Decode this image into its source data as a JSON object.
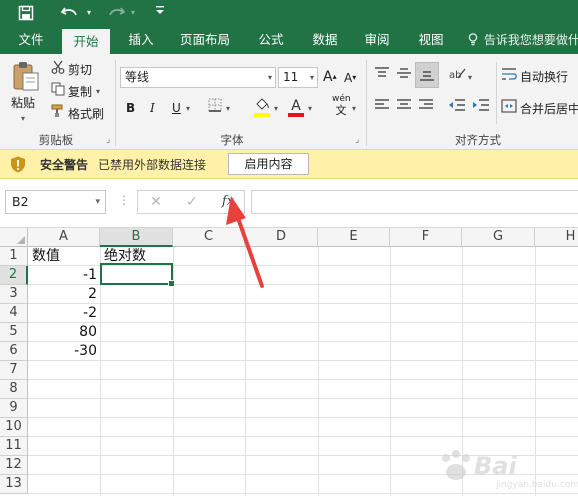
{
  "quick_access": {
    "save_icon": "save-icon",
    "undo_icon": "undo-icon",
    "redo_icon": "redo-icon",
    "customize_icon": "customize-qat-icon"
  },
  "tabs": [
    {
      "label": "文件"
    },
    {
      "label": "开始",
      "active": true
    },
    {
      "label": "插入"
    },
    {
      "label": "页面布局"
    },
    {
      "label": "公式"
    },
    {
      "label": "数据"
    },
    {
      "label": "审阅"
    },
    {
      "label": "视图"
    }
  ],
  "tell_me": "告诉我您想要做什",
  "ribbon": {
    "clipboard": {
      "paste_label": "粘贴",
      "cut_label": "剪切",
      "copy_label": "复制",
      "format_painter_label": "格式刷",
      "group_label": "剪贴板"
    },
    "font": {
      "font_name": "等线",
      "font_size": "11",
      "grow_label": "A",
      "shrink_label": "A",
      "bold_label": "B",
      "italic_label": "I",
      "underline_label": "U",
      "phonetic_top": "wén",
      "phonetic_bottom": "文",
      "group_label": "字体",
      "highlight_color": "#ffff00",
      "font_color": "#e0161b"
    },
    "alignment": {
      "wrap_text_label": "自动换行",
      "merge_center_label": "合并后居中",
      "group_label": "对齐方式"
    }
  },
  "security_bar": {
    "title": "安全警告",
    "message": "已禁用外部数据连接",
    "button_label": "启用内容"
  },
  "formula_bar": {
    "name_box": "B2",
    "cancel_label": "✕",
    "enter_label": "✓",
    "fx_label": "fx",
    "content": ""
  },
  "grid": {
    "columns": [
      "A",
      "B",
      "C",
      "D",
      "E",
      "F",
      "G",
      "H"
    ],
    "rows": [
      "1",
      "2",
      "3",
      "4",
      "5",
      "6",
      "7",
      "8",
      "9",
      "10",
      "11",
      "12",
      "13"
    ],
    "selected_cell": "B2",
    "cells": {
      "A1": "数值",
      "B1": "绝对数",
      "A2": "-1",
      "A3": "2",
      "A4": "-2",
      "A5": "80",
      "A6": "-30"
    }
  },
  "watermark": {
    "text": "Bai",
    "sub": "jingyan.baidu.com"
  },
  "colors": {
    "accent": "#217346",
    "security_bar": "#fff2a8",
    "arrow": "#e8413c"
  }
}
